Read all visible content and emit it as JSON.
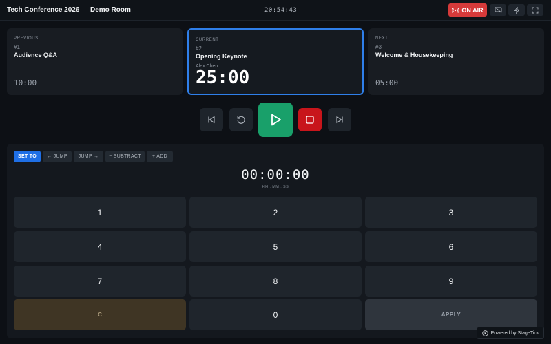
{
  "header": {
    "title": "Tech Conference 2026 — Demo Room",
    "clock": "20:54:43",
    "on_air_label": "ON AIR",
    "icons": [
      "broadcast-icon",
      "screen-off-icon",
      "lightning-icon",
      "fullscreen-icon"
    ]
  },
  "cards": {
    "previous": {
      "label": "PREVIOUS",
      "number": "#1",
      "title": "Audience Q&A",
      "time": "10:00"
    },
    "current": {
      "label": "CURRENT",
      "number": "#2",
      "title": "Opening Keynote",
      "presenter": "Alex Chen",
      "time": "25:00"
    },
    "next": {
      "label": "NEXT",
      "number": "#3",
      "title": "Welcome & Housekeeping",
      "time": "05:00"
    }
  },
  "transport": {
    "icons": [
      "skip-back-icon",
      "reset-icon",
      "play-icon",
      "stop-icon",
      "skip-forward-icon"
    ]
  },
  "keypad": {
    "modes": [
      "SET TO",
      "← JUMP",
      "JUMP →",
      "− SUBTRACT",
      "+ ADD"
    ],
    "active_mode": "SET TO",
    "display": "00:00:00",
    "hint": "HH : MM : SS",
    "keys": [
      "1",
      "2",
      "3",
      "4",
      "5",
      "6",
      "7",
      "8",
      "9",
      "C",
      "0",
      "APPLY"
    ]
  },
  "footer": {
    "powered_by": "Powered by StageTick"
  },
  "colors": {
    "accent": "#1f6fe5",
    "on_air": "#d63a3a",
    "play": "#19a06a",
    "stop": "#c8151b",
    "current_border": "#2f7fea"
  }
}
